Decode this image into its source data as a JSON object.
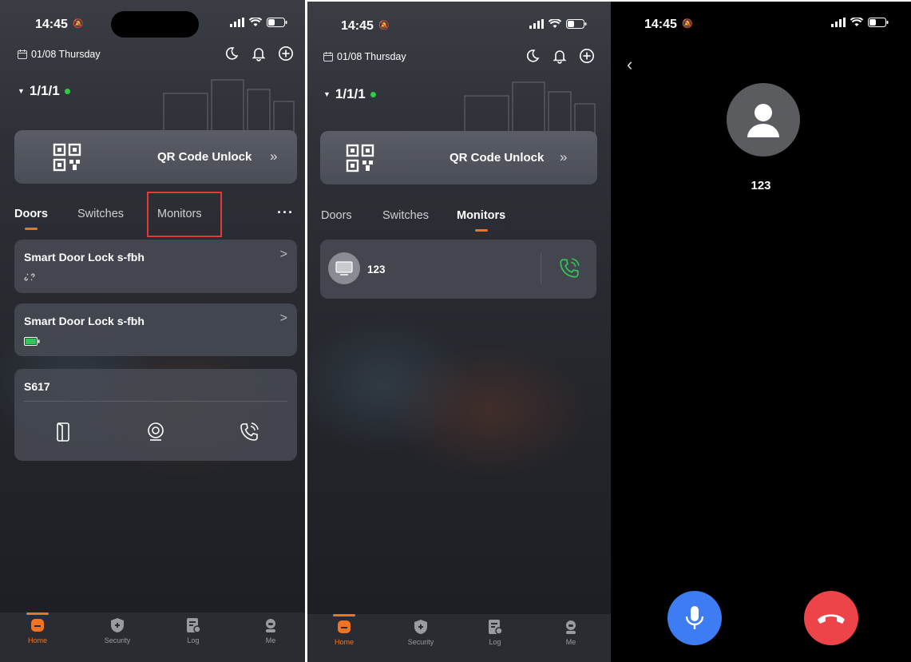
{
  "status": {
    "time": "14:45"
  },
  "home": {
    "date": "01/08 Thursday",
    "site": "1/1/1",
    "qr_label": "QR Code Unlock",
    "qr_arrow": "»",
    "tabs": [
      "Doors",
      "Switches",
      "Monitors"
    ],
    "more": "···",
    "doors": {
      "card1_title": "Smart Door Lock s-fbh",
      "card2_title": "Smart Door Lock s-fbh",
      "card3_title": "S617"
    },
    "monitor": {
      "name": "123"
    }
  },
  "tabbar": {
    "home": "Home",
    "security": "Security",
    "log": "Log",
    "me": "Me"
  },
  "call": {
    "name": "123",
    "back": "‹"
  },
  "colors": {
    "accent": "#f47321",
    "online": "#2ecc40",
    "call_green": "#35c45a",
    "mic_blue": "#3d7cf2",
    "end_red": "#ec4448",
    "highlight_red": "#e23a3a"
  }
}
